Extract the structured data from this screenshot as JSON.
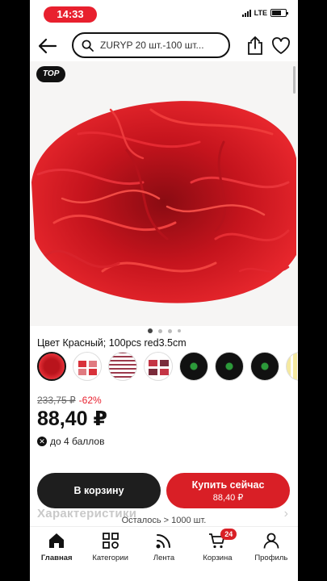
{
  "status_bar": {
    "time": "14:33",
    "network": "LTE"
  },
  "header": {
    "search_text": "ZURYP 20 шт.-100 шт..."
  },
  "gallery": {
    "badge": "TOP",
    "dot_count": 4,
    "active_dot": 0
  },
  "product": {
    "color_line": "Цвет Красный; 100pcs red3.5cm",
    "old_price": "233,75 ₽",
    "discount": "-62%",
    "price": "88,40 ₽",
    "points": "до 4 баллов"
  },
  "sections": {
    "characteristics": "Характеристики"
  },
  "actions": {
    "add_to_cart": "В корзину",
    "buy_now": "Купить сейчас",
    "buy_now_price": "88,40 ₽",
    "remaining": "Осталось > 1000 шт."
  },
  "nav": {
    "items": [
      {
        "label": "Главная",
        "icon": "home-icon"
      },
      {
        "label": "Категории",
        "icon": "categories-icon"
      },
      {
        "label": "Лента",
        "icon": "feed-icon"
      },
      {
        "label": "Корзина",
        "icon": "cart-icon"
      },
      {
        "label": "Профиль",
        "icon": "profile-icon"
      }
    ],
    "cart_count": "24"
  },
  "colors": {
    "accent": "#e8202e",
    "buy": "#d91f26",
    "dark": "#1e1e1e"
  }
}
